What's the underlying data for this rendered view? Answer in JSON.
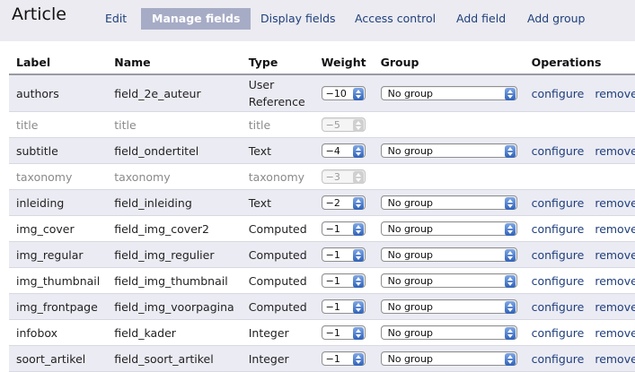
{
  "header": {
    "title": "Article",
    "tabs": [
      {
        "label": "Edit",
        "active": false
      },
      {
        "label": "Manage fields",
        "active": true
      },
      {
        "label": "Display fields",
        "active": false
      },
      {
        "label": "Access control",
        "active": false
      },
      {
        "label": "Add field",
        "active": false
      },
      {
        "label": "Add group",
        "active": false
      }
    ]
  },
  "table": {
    "columns": [
      "Label",
      "Name",
      "Type",
      "Weight",
      "Group",
      "Operations"
    ],
    "rows": [
      {
        "label": "authors",
        "name": "field_2e_auteur",
        "type": "User Reference",
        "weight": "−10",
        "group": "No group",
        "configure": "configure",
        "remove": "remove",
        "disabled": false
      },
      {
        "label": "title",
        "name": "title",
        "type": "title",
        "weight": "−5",
        "group": "",
        "configure": "",
        "remove": "",
        "disabled": true
      },
      {
        "label": "subtitle",
        "name": "field_ondertitel",
        "type": "Text",
        "weight": "−4",
        "group": "No group",
        "configure": "configure",
        "remove": "remove",
        "disabled": false
      },
      {
        "label": "taxonomy",
        "name": "taxonomy",
        "type": "taxonomy",
        "weight": "−3",
        "group": "",
        "configure": "",
        "remove": "",
        "disabled": true
      },
      {
        "label": "inleiding",
        "name": "field_inleiding",
        "type": "Text",
        "weight": "−2",
        "group": "No group",
        "configure": "configure",
        "remove": "remove",
        "disabled": false
      },
      {
        "label": "img_cover",
        "name": "field_img_cover2",
        "type": "Computed",
        "weight": "−1",
        "group": "No group",
        "configure": "configure",
        "remove": "remove",
        "disabled": false
      },
      {
        "label": "img_regular",
        "name": "field_img_regulier",
        "type": "Computed",
        "weight": "−1",
        "group": "No group",
        "configure": "configure",
        "remove": "remove",
        "disabled": false
      },
      {
        "label": "img_thumbnail",
        "name": "field_img_thumbnail",
        "type": "Computed",
        "weight": "−1",
        "group": "No group",
        "configure": "configure",
        "remove": "remove",
        "disabled": false
      },
      {
        "label": "img_frontpage",
        "name": "field_img_voorpagina",
        "type": "Computed",
        "weight": "−1",
        "group": "No group",
        "configure": "configure",
        "remove": "remove",
        "disabled": false
      },
      {
        "label": "infobox",
        "name": "field_kader",
        "type": "Integer",
        "weight": "−1",
        "group": "No group",
        "configure": "configure",
        "remove": "remove",
        "disabled": false
      },
      {
        "label": "soort_artikel",
        "name": "field_soort_artikel",
        "type": "Integer",
        "weight": "−1",
        "group": "No group",
        "configure": "configure",
        "remove": "remove",
        "disabled": false
      }
    ]
  },
  "colors": {
    "accent": "#1f3f7a",
    "active_tab_bg": "#a7acc6",
    "stripe": "#ebebf4",
    "select_arrow": "#3f74c8"
  }
}
